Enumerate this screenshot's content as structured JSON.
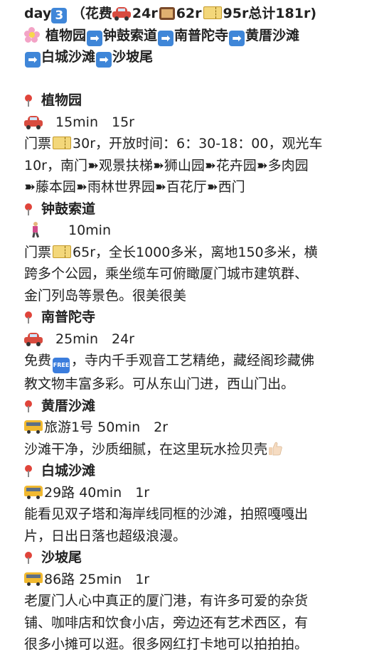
{
  "title": {
    "day": "day",
    "day_num": "3",
    "cost_open": "（花费",
    "car_cost": "24r",
    "food_cost": "62r",
    "ticket_cost": "95r总计181r)"
  },
  "route": {
    "stops": [
      "植物园",
      "钟鼓索道",
      "南普陀寺",
      "黄厝沙滩",
      "白城沙滩",
      "沙坡尾"
    ]
  },
  "sections": [
    {
      "name": "植物园",
      "transport": "15min　15r",
      "lines": [
        {
          "pre": "门票",
          "post": "30r，开放时间：6：30-18：00，观光车"
        },
        {
          "text": "10r，南门➽观景扶梯➽狮山园➽花卉园➽多肉园"
        },
        {
          "text": "➽藤本园➽雨林世界园➽百花厅➽西门"
        }
      ]
    },
    {
      "name": "钟鼓索道",
      "transport": "10min",
      "lines": [
        {
          "pre": "门票",
          "post": "65r，全长1000多米，离地150多米，横"
        },
        {
          "text": "跨多个公园，乘坐缆车可俯瞰厦门城市建筑群、"
        },
        {
          "text": "金门列岛等景色。很美很美"
        }
      ]
    },
    {
      "name": "南普陀寺",
      "transport": "25min　24r",
      "lines": [
        {
          "pre": "免费",
          "post": "，寺内千手观音工艺精绝，藏经阁珍藏佛"
        },
        {
          "text": "教文物丰富多彩。可从东山门进，西山门出。"
        }
      ]
    },
    {
      "name": "黄厝沙滩",
      "transport": "旅游1号  50min　2r",
      "lines": [
        {
          "text": "沙滩干净，沙质细腻，在这里玩水捡贝壳"
        }
      ]
    },
    {
      "name": "白城沙滩",
      "transport": "29路  40min　1r",
      "lines": [
        {
          "text": "能看见双子塔和海岸线同框的沙滩，拍照嘎嘎出"
        },
        {
          "text": "片，日出日落也超级浪漫。"
        }
      ]
    },
    {
      "name": "沙坡尾",
      "transport": "86路  25min　1r",
      "lines": [
        {
          "text": "老厦门人心中真正的厦门港，有许多可爱的杂货"
        },
        {
          "text": "铺、咖啡店和饮食小店，旁边还有艺术西区，有"
        },
        {
          "text": "很多小摊可以逛。很多网红打卡地可以拍拍拍。"
        }
      ]
    }
  ],
  "icons": {
    "free_badge": "FREE",
    "arrow": "➡"
  }
}
